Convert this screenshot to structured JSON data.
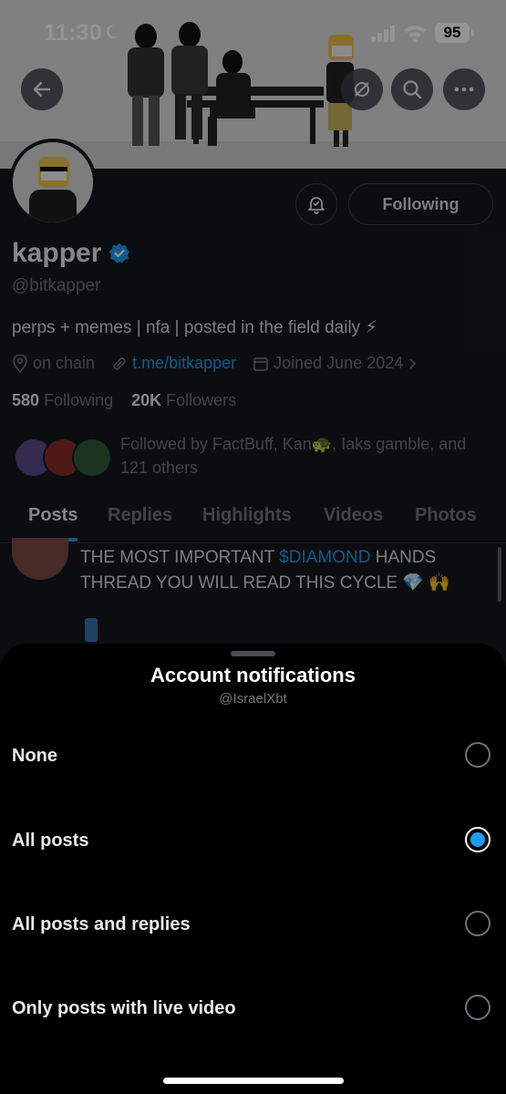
{
  "status_bar": {
    "time": "11:30",
    "battery": "95"
  },
  "profile": {
    "name": "kapper",
    "handle": "@bitkapper",
    "bio": "perps + memes | nfa | posted in the field daily ⚡",
    "location": "on chain",
    "link": "t.me/bitkapper",
    "joined": "Joined June 2024",
    "following_count": "580",
    "following_label": "Following",
    "followers_count": "20K",
    "followers_label": "Followers",
    "followed_by": "Followed by FactBuff, Kan🐢, Iaks gamble, and 121 others",
    "following_button": "Following"
  },
  "tabs": [
    {
      "label": "Posts",
      "active": true
    },
    {
      "label": "Replies"
    },
    {
      "label": "Highlights"
    },
    {
      "label": "Videos"
    },
    {
      "label": "Photos"
    }
  ],
  "post": {
    "text_pre": "THE MOST IMPORTANT ",
    "cashtag": "$DIAMOND",
    "text_post": " HANDS THREAD YOU WILL READ THIS CYCLE 💎 🙌"
  },
  "sheet": {
    "title": "Account notifications",
    "subtitle": "@IsraelXbt",
    "options": [
      {
        "label": "None",
        "selected": false
      },
      {
        "label": "All posts",
        "selected": true
      },
      {
        "label": "All posts and replies",
        "selected": false
      },
      {
        "label": "Only posts with live video",
        "selected": false
      }
    ]
  },
  "colors": {
    "accent": "#1d9bf0",
    "sheet_bg": "#000000",
    "page_bg": "#15181c",
    "muted_text": "#71767b"
  },
  "icons": [
    "back-arrow-icon",
    "notifications-off-icon",
    "search-icon",
    "more-icon",
    "bell-icon",
    "verified-badge-icon",
    "location-icon",
    "link-icon",
    "calendar-icon",
    "chevron-right-icon",
    "moon-icon",
    "signal-icon",
    "wifi-icon"
  ]
}
